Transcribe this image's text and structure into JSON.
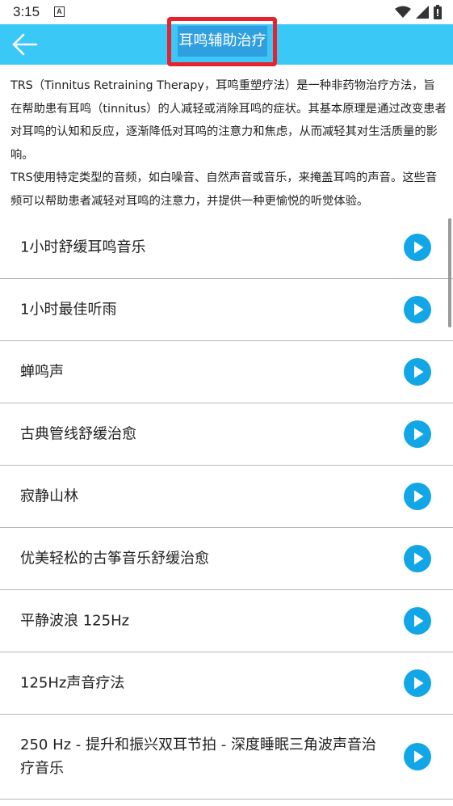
{
  "status_bar": {
    "time": "3:15",
    "notification_icon": "A"
  },
  "header": {
    "title": "耳鸣辅助治疗",
    "back_icon": "arrow-left-icon",
    "background_color": "#3ac8f6",
    "highlight_color": "#e8212e"
  },
  "description": {
    "paragraph1": "TRS（Tinnitus Retraining Therapy，耳鸣重塑疗法）是一种非药物治疗方法，旨在帮助患有耳鸣（tinnitus）的人减轻或消除耳鸣的症状。其基本原理是通过改变患者对耳鸣的认知和反应，逐渐降低对耳鸣的注意力和焦虑，从而减轻其对生活质量的影响。",
    "paragraph2": "TRS使用特定类型的音频，如白噪音、自然声音或音乐，来掩盖耳鸣的声音。这些音频可以帮助患者减轻对耳鸣的注意力，并提供一种更愉悦的听觉体验。"
  },
  "tracks": [
    {
      "title": "1小时舒缓耳鸣音乐"
    },
    {
      "title": "1小时最佳听雨"
    },
    {
      "title": "蝉鸣声"
    },
    {
      "title": "古典管线舒缓治愈"
    },
    {
      "title": "寂静山林"
    },
    {
      "title": "优美轻松的古筝音乐舒缓治愈"
    },
    {
      "title": "平静波浪 125Hz"
    },
    {
      "title": "125Hz声音疗法"
    },
    {
      "title": "250 Hz - 提升和振兴双耳节拍 - 深度睡眠三角波声音治疗音乐"
    }
  ],
  "play_icon": "play-circle-icon",
  "accent_color": "#12a6e6"
}
